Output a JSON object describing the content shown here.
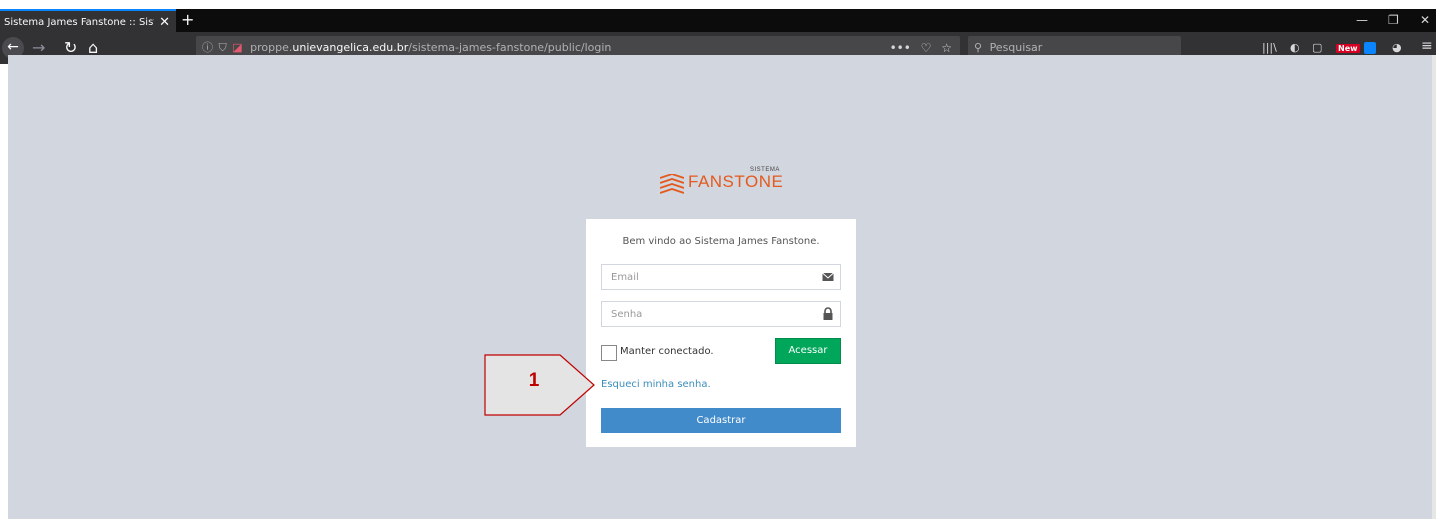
{
  "browser": {
    "tab_title": "Sistema James Fanstone :: Sistemas",
    "tab_close": "✕",
    "new_tab": "+",
    "url_prefix": "proppe.",
    "url_domain": "unievangelica.edu.br",
    "url_path": "/sistema-james-fanstone/public/login",
    "search_placeholder": "Pesquisar",
    "new_badge": "New"
  },
  "logo": {
    "name": "FANSTONE",
    "subtitle": "SISTEMA"
  },
  "login": {
    "welcome": "Bem vindo ao Sistema James Fanstone.",
    "email_placeholder": "Email",
    "password_placeholder": "Senha",
    "remember_label": "Manter conectado.",
    "login_button": "Acessar",
    "forgot_link": "Esqueci minha senha.",
    "register_button": "Cadastrar"
  },
  "annotation": {
    "number": "1"
  },
  "colors": {
    "page_bg": "#d2d6de",
    "brand_orange": "#e35a1f",
    "login_green": "#00a65a",
    "register_blue": "#428bca",
    "link_blue": "#3c8dbc",
    "annotation_red": "#c00000"
  }
}
